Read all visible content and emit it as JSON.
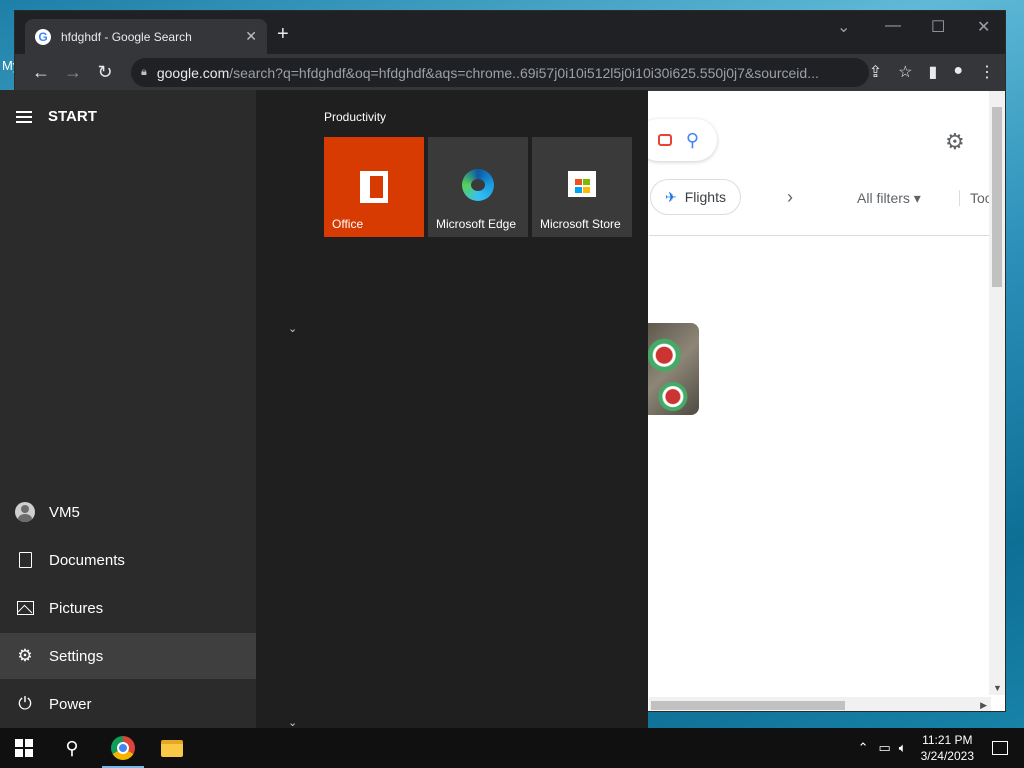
{
  "desktop": {
    "label": "My"
  },
  "browser": {
    "tab_title": "hfdghdf - Google Search",
    "tab_close": "✕",
    "new_tab": "+",
    "url_host": "google.com",
    "url_path": "/search?q=hfdghdf&oq=hfdghdf&aqs=chrome..69i57j0i10i512l5j0i10i30i625.550j0j7&sourceid...",
    "window_controls": {
      "dropdown": "⌄",
      "minimize": "—",
      "maximize": "☐",
      "close": "✕"
    }
  },
  "google": {
    "chip_label": "Flights",
    "all_filters": "All filters ▾",
    "tools": "Tools"
  },
  "start_menu": {
    "title": "START",
    "group_label": "Productivity",
    "user": "VM5",
    "items": [
      {
        "label": "Documents"
      },
      {
        "label": "Pictures"
      },
      {
        "label": "Settings"
      },
      {
        "label": "Power"
      }
    ],
    "tiles": [
      {
        "label": "Office",
        "color": "#d83b01"
      },
      {
        "label": "Microsoft Edge",
        "color": "#3a3a3a"
      },
      {
        "label": "Microsoft Store",
        "color": "#3a3a3a"
      }
    ]
  },
  "taskbar": {
    "time": "11:21 PM",
    "date": "3/24/2023"
  }
}
